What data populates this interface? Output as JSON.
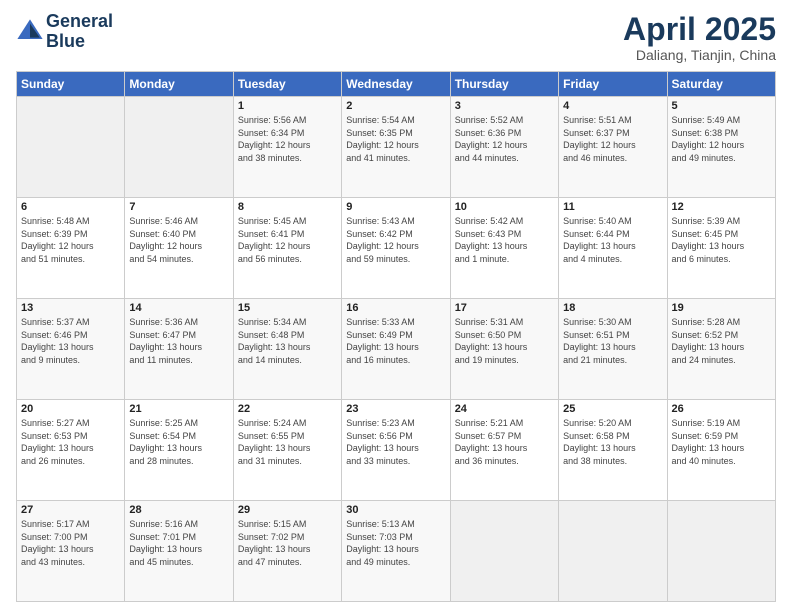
{
  "header": {
    "logo_line1": "General",
    "logo_line2": "Blue",
    "month": "April 2025",
    "location": "Daliang, Tianjin, China"
  },
  "weekdays": [
    "Sunday",
    "Monday",
    "Tuesday",
    "Wednesday",
    "Thursday",
    "Friday",
    "Saturday"
  ],
  "weeks": [
    [
      {
        "day": "",
        "info": ""
      },
      {
        "day": "",
        "info": ""
      },
      {
        "day": "1",
        "info": "Sunrise: 5:56 AM\nSunset: 6:34 PM\nDaylight: 12 hours\nand 38 minutes."
      },
      {
        "day": "2",
        "info": "Sunrise: 5:54 AM\nSunset: 6:35 PM\nDaylight: 12 hours\nand 41 minutes."
      },
      {
        "day": "3",
        "info": "Sunrise: 5:52 AM\nSunset: 6:36 PM\nDaylight: 12 hours\nand 44 minutes."
      },
      {
        "day": "4",
        "info": "Sunrise: 5:51 AM\nSunset: 6:37 PM\nDaylight: 12 hours\nand 46 minutes."
      },
      {
        "day": "5",
        "info": "Sunrise: 5:49 AM\nSunset: 6:38 PM\nDaylight: 12 hours\nand 49 minutes."
      }
    ],
    [
      {
        "day": "6",
        "info": "Sunrise: 5:48 AM\nSunset: 6:39 PM\nDaylight: 12 hours\nand 51 minutes."
      },
      {
        "day": "7",
        "info": "Sunrise: 5:46 AM\nSunset: 6:40 PM\nDaylight: 12 hours\nand 54 minutes."
      },
      {
        "day": "8",
        "info": "Sunrise: 5:45 AM\nSunset: 6:41 PM\nDaylight: 12 hours\nand 56 minutes."
      },
      {
        "day": "9",
        "info": "Sunrise: 5:43 AM\nSunset: 6:42 PM\nDaylight: 12 hours\nand 59 minutes."
      },
      {
        "day": "10",
        "info": "Sunrise: 5:42 AM\nSunset: 6:43 PM\nDaylight: 13 hours\nand 1 minute."
      },
      {
        "day": "11",
        "info": "Sunrise: 5:40 AM\nSunset: 6:44 PM\nDaylight: 13 hours\nand 4 minutes."
      },
      {
        "day": "12",
        "info": "Sunrise: 5:39 AM\nSunset: 6:45 PM\nDaylight: 13 hours\nand 6 minutes."
      }
    ],
    [
      {
        "day": "13",
        "info": "Sunrise: 5:37 AM\nSunset: 6:46 PM\nDaylight: 13 hours\nand 9 minutes."
      },
      {
        "day": "14",
        "info": "Sunrise: 5:36 AM\nSunset: 6:47 PM\nDaylight: 13 hours\nand 11 minutes."
      },
      {
        "day": "15",
        "info": "Sunrise: 5:34 AM\nSunset: 6:48 PM\nDaylight: 13 hours\nand 14 minutes."
      },
      {
        "day": "16",
        "info": "Sunrise: 5:33 AM\nSunset: 6:49 PM\nDaylight: 13 hours\nand 16 minutes."
      },
      {
        "day": "17",
        "info": "Sunrise: 5:31 AM\nSunset: 6:50 PM\nDaylight: 13 hours\nand 19 minutes."
      },
      {
        "day": "18",
        "info": "Sunrise: 5:30 AM\nSunset: 6:51 PM\nDaylight: 13 hours\nand 21 minutes."
      },
      {
        "day": "19",
        "info": "Sunrise: 5:28 AM\nSunset: 6:52 PM\nDaylight: 13 hours\nand 24 minutes."
      }
    ],
    [
      {
        "day": "20",
        "info": "Sunrise: 5:27 AM\nSunset: 6:53 PM\nDaylight: 13 hours\nand 26 minutes."
      },
      {
        "day": "21",
        "info": "Sunrise: 5:25 AM\nSunset: 6:54 PM\nDaylight: 13 hours\nand 28 minutes."
      },
      {
        "day": "22",
        "info": "Sunrise: 5:24 AM\nSunset: 6:55 PM\nDaylight: 13 hours\nand 31 minutes."
      },
      {
        "day": "23",
        "info": "Sunrise: 5:23 AM\nSunset: 6:56 PM\nDaylight: 13 hours\nand 33 minutes."
      },
      {
        "day": "24",
        "info": "Sunrise: 5:21 AM\nSunset: 6:57 PM\nDaylight: 13 hours\nand 36 minutes."
      },
      {
        "day": "25",
        "info": "Sunrise: 5:20 AM\nSunset: 6:58 PM\nDaylight: 13 hours\nand 38 minutes."
      },
      {
        "day": "26",
        "info": "Sunrise: 5:19 AM\nSunset: 6:59 PM\nDaylight: 13 hours\nand 40 minutes."
      }
    ],
    [
      {
        "day": "27",
        "info": "Sunrise: 5:17 AM\nSunset: 7:00 PM\nDaylight: 13 hours\nand 43 minutes."
      },
      {
        "day": "28",
        "info": "Sunrise: 5:16 AM\nSunset: 7:01 PM\nDaylight: 13 hours\nand 45 minutes."
      },
      {
        "day": "29",
        "info": "Sunrise: 5:15 AM\nSunset: 7:02 PM\nDaylight: 13 hours\nand 47 minutes."
      },
      {
        "day": "30",
        "info": "Sunrise: 5:13 AM\nSunset: 7:03 PM\nDaylight: 13 hours\nand 49 minutes."
      },
      {
        "day": "",
        "info": ""
      },
      {
        "day": "",
        "info": ""
      },
      {
        "day": "",
        "info": ""
      }
    ]
  ]
}
